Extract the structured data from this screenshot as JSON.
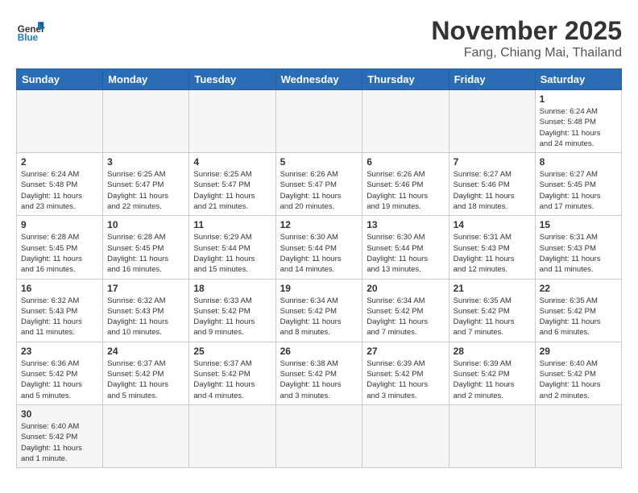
{
  "header": {
    "logo_general": "General",
    "logo_blue": "Blue",
    "month_title": "November 2025",
    "location": "Fang, Chiang Mai, Thailand"
  },
  "weekdays": [
    "Sunday",
    "Monday",
    "Tuesday",
    "Wednesday",
    "Thursday",
    "Friday",
    "Saturday"
  ],
  "weeks": [
    [
      {
        "day": "",
        "info": ""
      },
      {
        "day": "",
        "info": ""
      },
      {
        "day": "",
        "info": ""
      },
      {
        "day": "",
        "info": ""
      },
      {
        "day": "",
        "info": ""
      },
      {
        "day": "",
        "info": ""
      },
      {
        "day": "1",
        "info": "Sunrise: 6:24 AM\nSunset: 5:48 PM\nDaylight: 11 hours\nand 24 minutes."
      }
    ],
    [
      {
        "day": "2",
        "info": "Sunrise: 6:24 AM\nSunset: 5:48 PM\nDaylight: 11 hours\nand 23 minutes."
      },
      {
        "day": "3",
        "info": "Sunrise: 6:25 AM\nSunset: 5:47 PM\nDaylight: 11 hours\nand 22 minutes."
      },
      {
        "day": "4",
        "info": "Sunrise: 6:25 AM\nSunset: 5:47 PM\nDaylight: 11 hours\nand 21 minutes."
      },
      {
        "day": "5",
        "info": "Sunrise: 6:26 AM\nSunset: 5:47 PM\nDaylight: 11 hours\nand 20 minutes."
      },
      {
        "day": "6",
        "info": "Sunrise: 6:26 AM\nSunset: 5:46 PM\nDaylight: 11 hours\nand 19 minutes."
      },
      {
        "day": "7",
        "info": "Sunrise: 6:27 AM\nSunset: 5:46 PM\nDaylight: 11 hours\nand 18 minutes."
      },
      {
        "day": "8",
        "info": "Sunrise: 6:27 AM\nSunset: 5:45 PM\nDaylight: 11 hours\nand 17 minutes."
      }
    ],
    [
      {
        "day": "9",
        "info": "Sunrise: 6:28 AM\nSunset: 5:45 PM\nDaylight: 11 hours\nand 16 minutes."
      },
      {
        "day": "10",
        "info": "Sunrise: 6:28 AM\nSunset: 5:45 PM\nDaylight: 11 hours\nand 16 minutes."
      },
      {
        "day": "11",
        "info": "Sunrise: 6:29 AM\nSunset: 5:44 PM\nDaylight: 11 hours\nand 15 minutes."
      },
      {
        "day": "12",
        "info": "Sunrise: 6:30 AM\nSunset: 5:44 PM\nDaylight: 11 hours\nand 14 minutes."
      },
      {
        "day": "13",
        "info": "Sunrise: 6:30 AM\nSunset: 5:44 PM\nDaylight: 11 hours\nand 13 minutes."
      },
      {
        "day": "14",
        "info": "Sunrise: 6:31 AM\nSunset: 5:43 PM\nDaylight: 11 hours\nand 12 minutes."
      },
      {
        "day": "15",
        "info": "Sunrise: 6:31 AM\nSunset: 5:43 PM\nDaylight: 11 hours\nand 11 minutes."
      }
    ],
    [
      {
        "day": "16",
        "info": "Sunrise: 6:32 AM\nSunset: 5:43 PM\nDaylight: 11 hours\nand 11 minutes."
      },
      {
        "day": "17",
        "info": "Sunrise: 6:32 AM\nSunset: 5:43 PM\nDaylight: 11 hours\nand 10 minutes."
      },
      {
        "day": "18",
        "info": "Sunrise: 6:33 AM\nSunset: 5:42 PM\nDaylight: 11 hours\nand 9 minutes."
      },
      {
        "day": "19",
        "info": "Sunrise: 6:34 AM\nSunset: 5:42 PM\nDaylight: 11 hours\nand 8 minutes."
      },
      {
        "day": "20",
        "info": "Sunrise: 6:34 AM\nSunset: 5:42 PM\nDaylight: 11 hours\nand 7 minutes."
      },
      {
        "day": "21",
        "info": "Sunrise: 6:35 AM\nSunset: 5:42 PM\nDaylight: 11 hours\nand 7 minutes."
      },
      {
        "day": "22",
        "info": "Sunrise: 6:35 AM\nSunset: 5:42 PM\nDaylight: 11 hours\nand 6 minutes."
      }
    ],
    [
      {
        "day": "23",
        "info": "Sunrise: 6:36 AM\nSunset: 5:42 PM\nDaylight: 11 hours\nand 5 minutes."
      },
      {
        "day": "24",
        "info": "Sunrise: 6:37 AM\nSunset: 5:42 PM\nDaylight: 11 hours\nand 5 minutes."
      },
      {
        "day": "25",
        "info": "Sunrise: 6:37 AM\nSunset: 5:42 PM\nDaylight: 11 hours\nand 4 minutes."
      },
      {
        "day": "26",
        "info": "Sunrise: 6:38 AM\nSunset: 5:42 PM\nDaylight: 11 hours\nand 3 minutes."
      },
      {
        "day": "27",
        "info": "Sunrise: 6:39 AM\nSunset: 5:42 PM\nDaylight: 11 hours\nand 3 minutes."
      },
      {
        "day": "28",
        "info": "Sunrise: 6:39 AM\nSunset: 5:42 PM\nDaylight: 11 hours\nand 2 minutes."
      },
      {
        "day": "29",
        "info": "Sunrise: 6:40 AM\nSunset: 5:42 PM\nDaylight: 11 hours\nand 2 minutes."
      }
    ],
    [
      {
        "day": "30",
        "info": "Sunrise: 6:40 AM\nSunset: 5:42 PM\nDaylight: 11 hours\nand 1 minute."
      },
      {
        "day": "",
        "info": ""
      },
      {
        "day": "",
        "info": ""
      },
      {
        "day": "",
        "info": ""
      },
      {
        "day": "",
        "info": ""
      },
      {
        "day": "",
        "info": ""
      },
      {
        "day": "",
        "info": ""
      }
    ]
  ]
}
